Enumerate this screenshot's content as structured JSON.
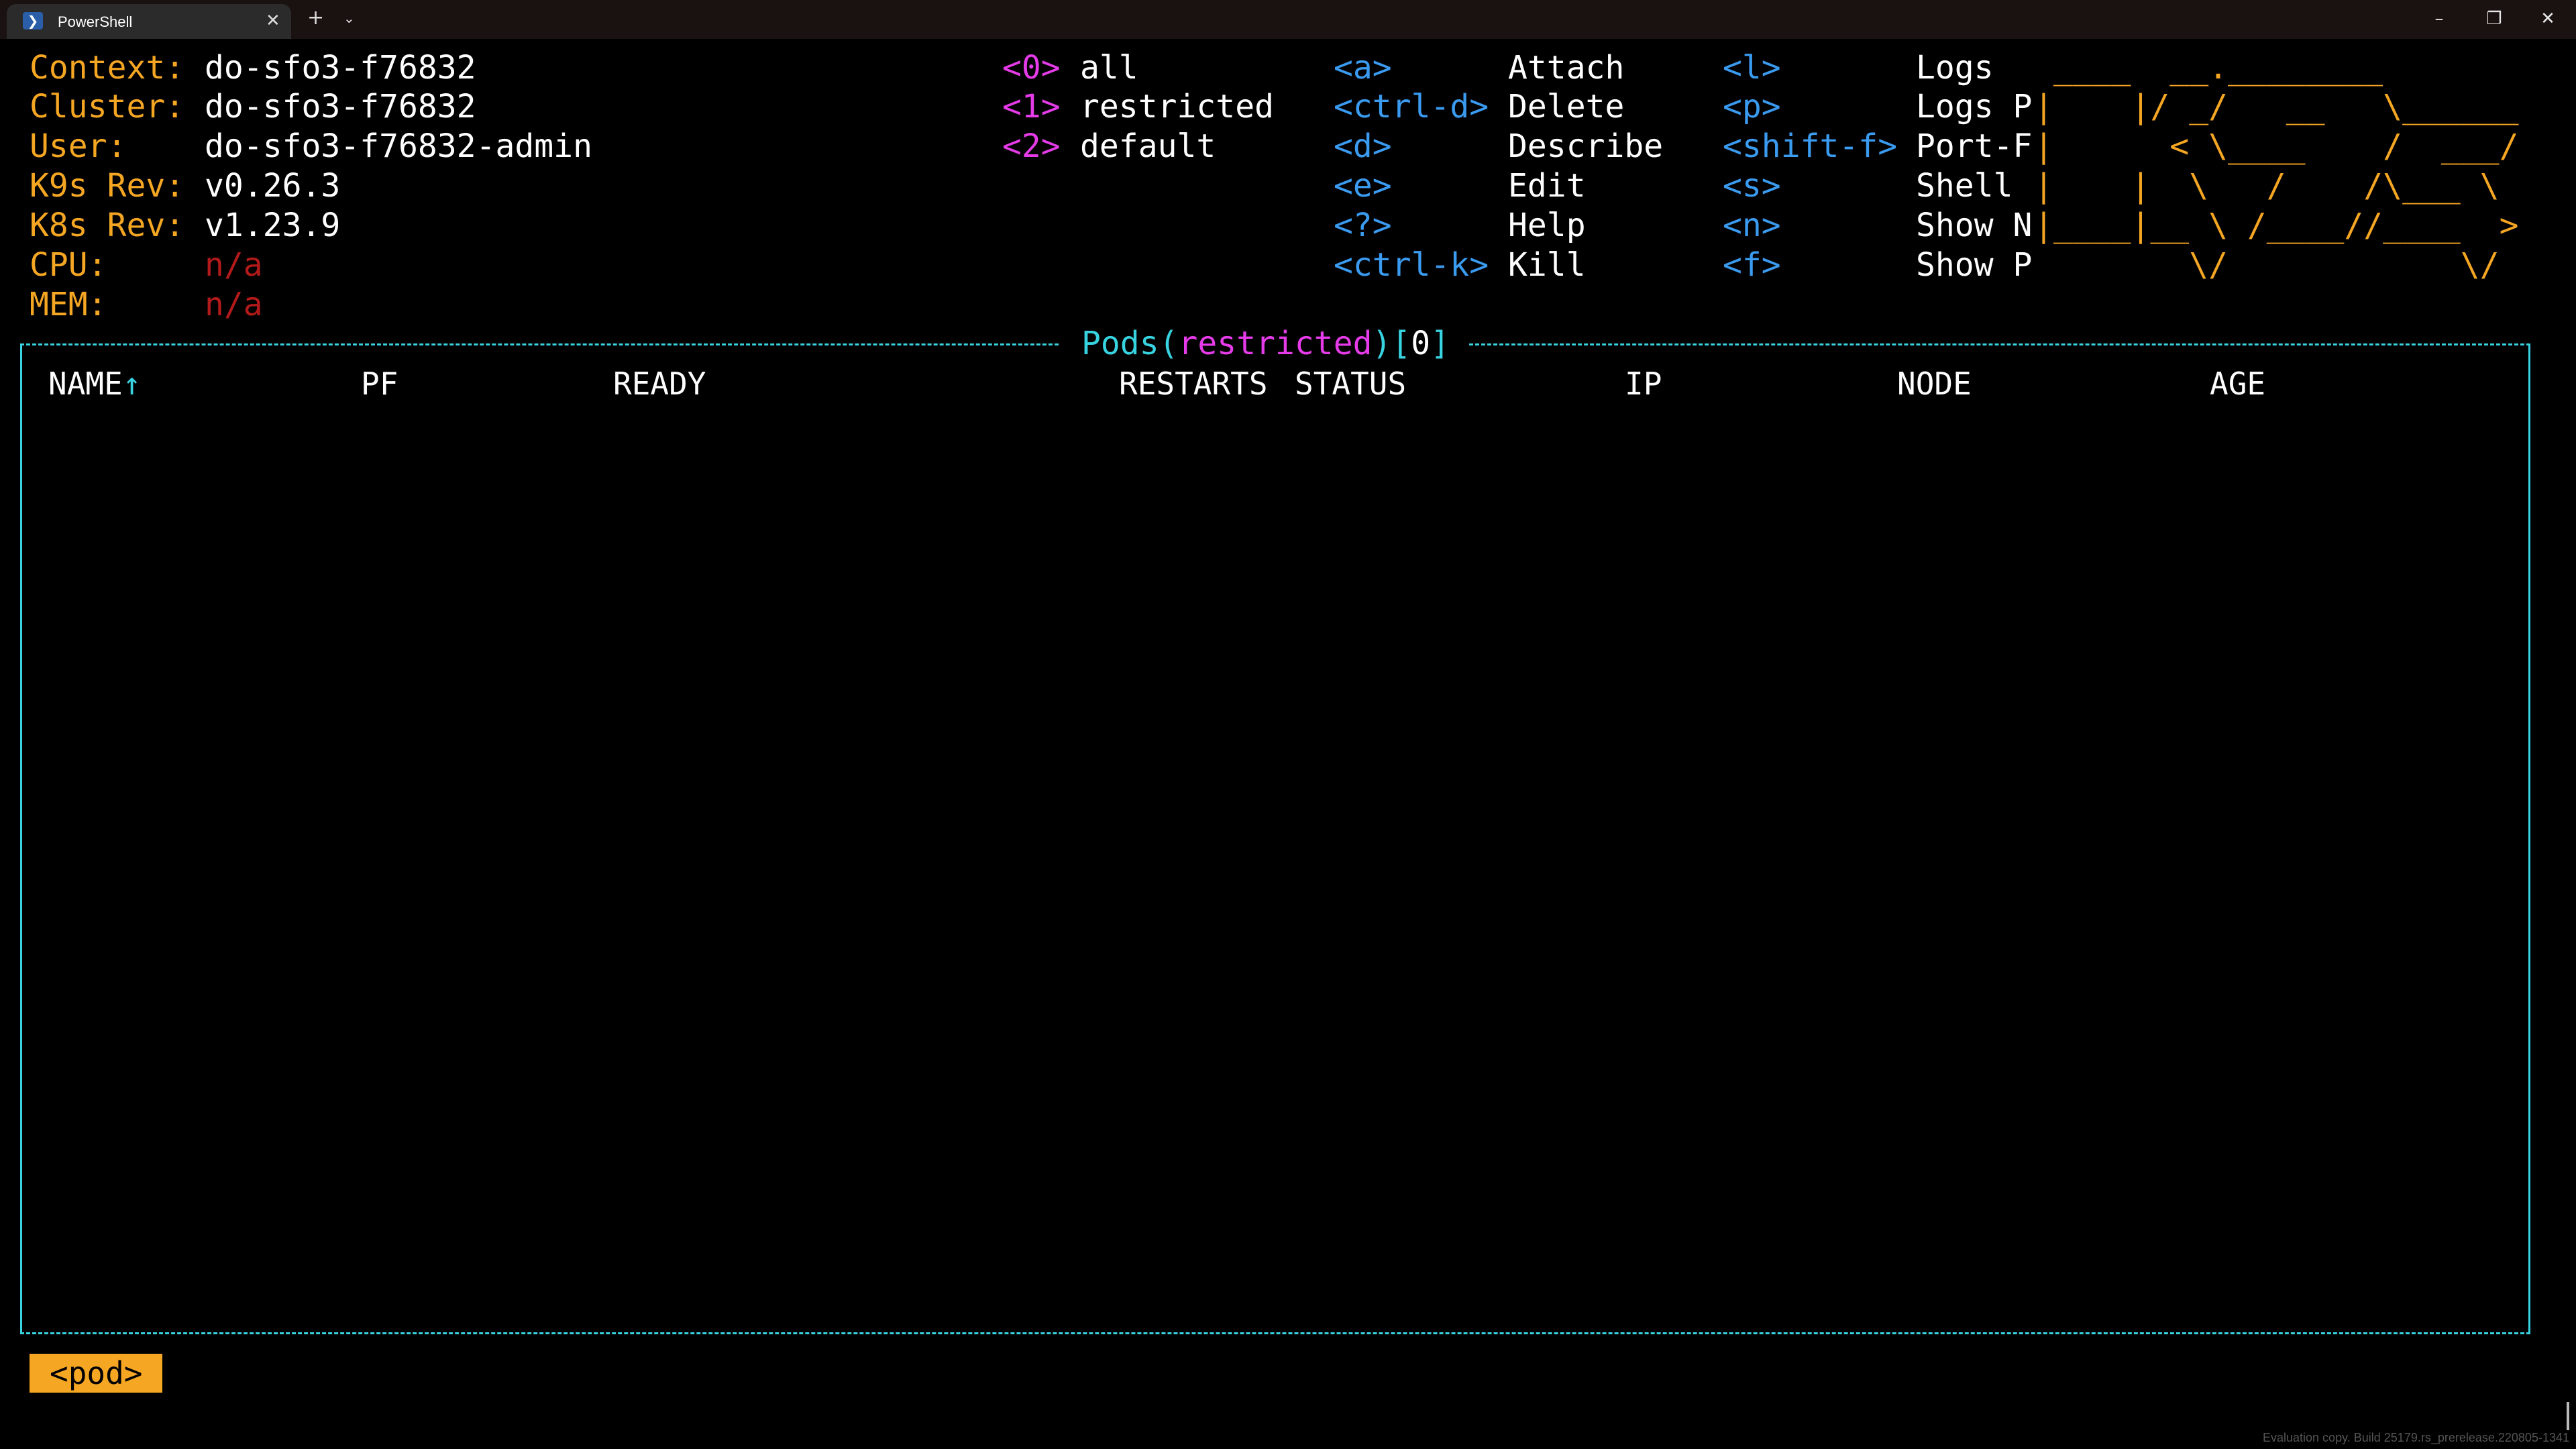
{
  "window": {
    "tab_title": "PowerShell",
    "tab_icon": "powershell-icon",
    "close_tab": "✕",
    "new_tab": "+",
    "dropdown": "⌄",
    "minimize": "–",
    "restore": "❐",
    "close": "✕"
  },
  "info": {
    "context_label": "Context:",
    "context_value": "do-sfo3-f76832",
    "cluster_label": "Cluster:",
    "cluster_value": "do-sfo3-f76832",
    "user_label": "User:",
    "user_value": "do-sfo3-f76832-admin",
    "k9s_label": "K9s Rev:",
    "k9s_value": "v0.26.3",
    "k8s_label": "K8s Rev:",
    "k8s_value": "v1.23.9",
    "cpu_label": "CPU:",
    "cpu_value": "n/a",
    "mem_label": "MEM:",
    "mem_value": "n/a"
  },
  "namespaces": [
    {
      "key": "<0>",
      "label": "all"
    },
    {
      "key": "<1>",
      "label": "restricted"
    },
    {
      "key": "<2>",
      "label": "default"
    }
  ],
  "hotkeys_a": [
    {
      "key": "<a>",
      "label": "Attach"
    },
    {
      "key": "<ctrl-d>",
      "label": "Delete"
    },
    {
      "key": "<d>",
      "label": "Describe"
    },
    {
      "key": "<e>",
      "label": "Edit"
    },
    {
      "key": "<?>",
      "label": "Help"
    },
    {
      "key": "<ctrl-k>",
      "label": "Kill"
    }
  ],
  "hotkeys_b": [
    {
      "key": "<l>",
      "label": "Logs"
    },
    {
      "key": "<p>",
      "label": "Logs P"
    },
    {
      "key": "<shift-f>",
      "label": "Port-F"
    },
    {
      "key": "<s>",
      "label": "Shell"
    },
    {
      "key": "<n>",
      "label": "Show N"
    },
    {
      "key": "<f>",
      "label": "Show P"
    }
  ],
  "logo_lines": [
    " ____  __.________       ",
    "|    |/ _/   __   \\______",
    "|      < \\____    /  ___/",
    "|    |  \\   /    /\\___ \\ ",
    "|____|__ \\ /____//____  >",
    "        \\/            \\/ "
  ],
  "table": {
    "resource": "Pods",
    "namespace": "restricted",
    "count": "0",
    "columns": [
      "NAME↑",
      "PF",
      "READY",
      "RESTARTS",
      "STATUS",
      "IP",
      "NODE",
      "AGE"
    ]
  },
  "breadcrumb": "<pod>",
  "watermark": "Evaluation copy. Build 25179.rs_prerelease.220805-1341"
}
